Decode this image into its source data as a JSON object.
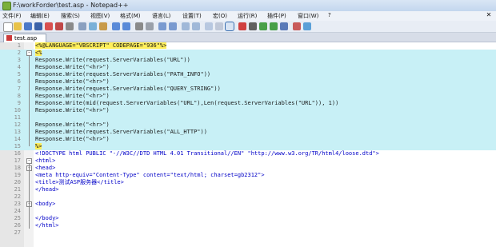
{
  "window": {
    "title": "F:\\workForder\\test.asp - Notepad++"
  },
  "menu": [
    "文件(F)",
    "编辑(E)",
    "搜索(S)",
    "视图(V)",
    "格式(M)",
    "语言(L)",
    "设置(T)",
    "宏(O)",
    "运行(R)",
    "插件(P)",
    "窗口(W)",
    "?"
  ],
  "tab": {
    "label": "test.asp"
  },
  "lines": [
    {
      "n": "1",
      "text": "<%@LANGUAGE=\"VBSCRIPT\" CODEPAGE=\"936\"%>"
    },
    {
      "n": "2",
      "text": "<%"
    },
    {
      "n": "3",
      "text": "Response.Write(request.ServerVariables(\"URL\"))"
    },
    {
      "n": "4",
      "text": "Response.Write(\"<hr>\")"
    },
    {
      "n": "5",
      "text": "Response.Write(request.ServerVariables(\"PATH_INFO\"))"
    },
    {
      "n": "6",
      "text": "Response.Write(\"<hr>\")"
    },
    {
      "n": "7",
      "text": "Response.Write(request.ServerVariables(\"QUERY_STRING\"))"
    },
    {
      "n": "8",
      "text": "Response.Write(\"<hr>\")"
    },
    {
      "n": "9",
      "text": "Response.Write(mid(request.ServerVariables(\"URL\"),Len(request.ServerVariables(\"URL\")), 1))"
    },
    {
      "n": "10",
      "text": "Response.Write(\"<hr>\")"
    },
    {
      "n": "11",
      "text": ""
    },
    {
      "n": "12",
      "text": "Response.Write(\"<hr>\")"
    },
    {
      "n": "13",
      "text": "Response.Write(request.ServerVariables(\"ALL_HTTP\"))"
    },
    {
      "n": "14",
      "text": "Response.Write(\"<hr>\")"
    },
    {
      "n": "15",
      "text": "%>"
    },
    {
      "n": "16",
      "text": "<!DOCTYPE html PUBLIC \"-//W3C//DTD HTML 4.01 Transitional//EN\" \"http://www.w3.org/TR/html4/loose.dtd\">"
    },
    {
      "n": "17",
      "text": "<html>"
    },
    {
      "n": "18",
      "text": "<head>"
    },
    {
      "n": "19",
      "text": "<meta http-equiv=\"Content-Type\" content=\"text/html; charset=gb2312\">"
    },
    {
      "n": "20",
      "text": "<title>测试ASP服务器</title>"
    },
    {
      "n": "21",
      "text": "</head>"
    },
    {
      "n": "22",
      "text": ""
    },
    {
      "n": "23",
      "text": "<body>"
    },
    {
      "n": "24",
      "text": ""
    },
    {
      "n": "25",
      "text": "</body>"
    },
    {
      "n": "26",
      "text": "</html>"
    },
    {
      "n": "27",
      "text": ""
    }
  ],
  "colors": {
    "highlight": "#c8f0f6",
    "delimiter": "#ffef5a",
    "tag": "#0000c8",
    "attribute": "#c80000"
  }
}
